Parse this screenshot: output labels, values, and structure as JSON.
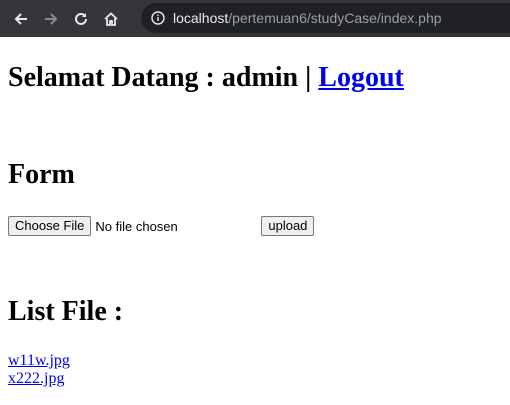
{
  "browser": {
    "url_host": "localhost",
    "url_path": "/pertemuan6/studyCase/index.php"
  },
  "header": {
    "welcome_text": "Selamat Datang : admin | ",
    "logout_label": "Logout"
  },
  "form": {
    "title": "Form",
    "choose_file_label": "Choose File",
    "file_status": "No file chosen",
    "upload_label": "upload"
  },
  "list": {
    "title": "List File :",
    "files": [
      "w11w.jpg",
      "x222.jpg"
    ]
  },
  "colors": {
    "toolbar_bg": "#35363a",
    "omnibox_bg": "#202124",
    "link": "#0000ee"
  },
  "icons": [
    "back-arrow-icon",
    "forward-arrow-icon",
    "reload-icon",
    "home-icon",
    "info-icon"
  ]
}
